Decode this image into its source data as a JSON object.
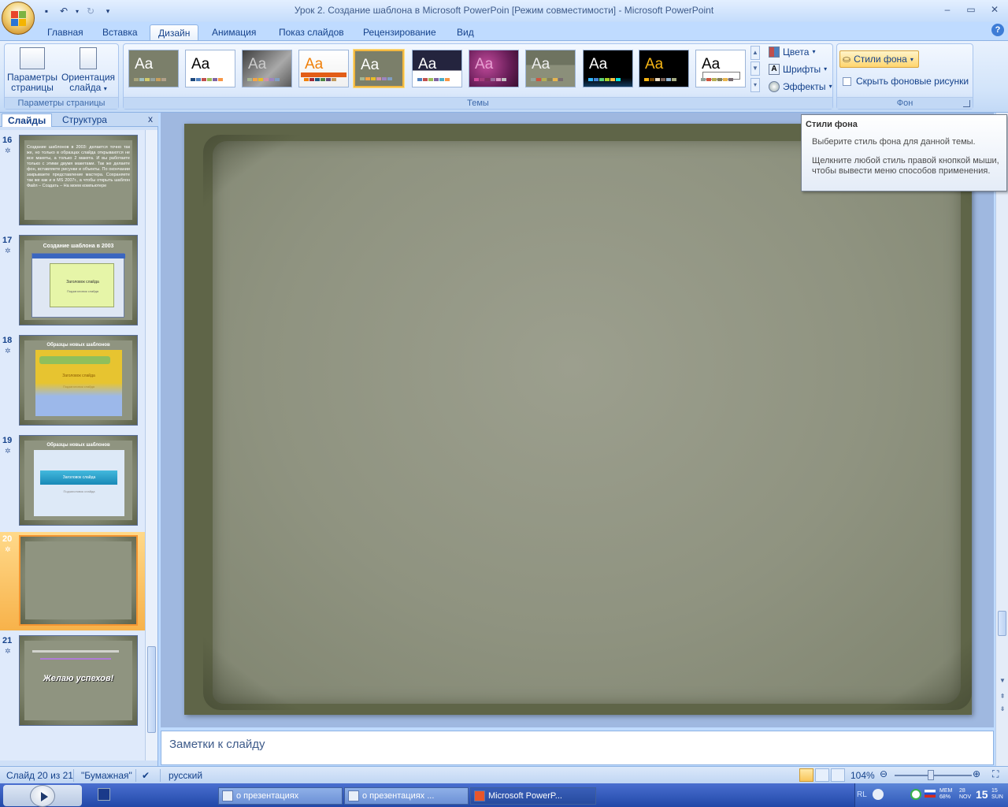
{
  "window": {
    "title": "Урок 2. Создание шаблона в Microsoft PowerPoin [Режим совместимости] - Microsoft PowerPoint"
  },
  "tabs": [
    "Главная",
    "Вставка",
    "Дизайн",
    "Анимация",
    "Показ слайдов",
    "Рецензирование",
    "Вид"
  ],
  "active_tab": "Дизайн",
  "ribbon": {
    "page_setup": {
      "params_label": "Параметры страницы",
      "orientation_label": "Ориентация слайда",
      "group_label": "Параметры страницы"
    },
    "themes": {
      "group_label": "Темы",
      "thumb_text": "Aa",
      "colors_label": "Цвета",
      "fonts_label": "Шрифты",
      "effects_label": "Эффекты"
    },
    "background": {
      "styles_label": "Стили фона",
      "hide_label": "Скрыть фоновые рисунки",
      "group_label": "Фон"
    }
  },
  "pane": {
    "tab_slides": "Слайды",
    "tab_outline": "Структура",
    "close": "x",
    "slides": [
      {
        "num": "16",
        "title": ""
      },
      {
        "num": "17",
        "title": "Создание шаблона в 2003"
      },
      {
        "num": "18",
        "title": "Образцы новых шаблонов"
      },
      {
        "num": "19",
        "title": "Образцы новых шаблонов"
      },
      {
        "num": "20",
        "title": ""
      },
      {
        "num": "21",
        "title": "Желаю успехов!"
      }
    ],
    "slide16_text": "Создание шаблонов в 2003: делается точно так же, но только в образцах слайда открываются не все макеты, а только 2 макета. И вы работаете только с этими двумя макетами. Так же делаете фон, вставляете рисунки и объекты. По окончании закрываете представление мастера. Сохраняете так же как и в MS 2007г., а чтобы открыть шаблон Файл – Создать – На моем компьютере",
    "slide17_heading": "Заголовок слайда",
    "slide17_sub": "Подзаголовок слайда",
    "slide18_heading": "Заголовок слайда",
    "slide18_sub": "Подзаголовок слайда",
    "slide19_heading": "Заголовок слайда",
    "slide19_sub": "Подзаголовок слайда"
  },
  "tooltip": {
    "title": "Стили фона",
    "line1": "Выберите стиль фона для данной темы.",
    "line2": "Щелкните любой стиль правой кнопкой мыши, чтобы вывести меню способов применения."
  },
  "notes": {
    "placeholder": "Заметки к слайду"
  },
  "status": {
    "slide_info": "Слайд 20 из 21",
    "theme_name": "\"Бумажная\"",
    "language": "русский",
    "zoom": "104%"
  },
  "taskbar": {
    "tasks": [
      "о презентациях",
      "о презентациях ...",
      "Microsoft PowerP..."
    ],
    "lang": "RL",
    "mem": "MEM",
    "mem_val": "68%",
    "date_day": "28",
    "date_month": "NOV",
    "time": "15",
    "time2": "15",
    "dow": "SUN"
  },
  "colors": {
    "accent": "#15428b",
    "ribbon_bg": "#dce9fb",
    "selected": "#f3b840",
    "slide_bg": "#8f9380"
  }
}
